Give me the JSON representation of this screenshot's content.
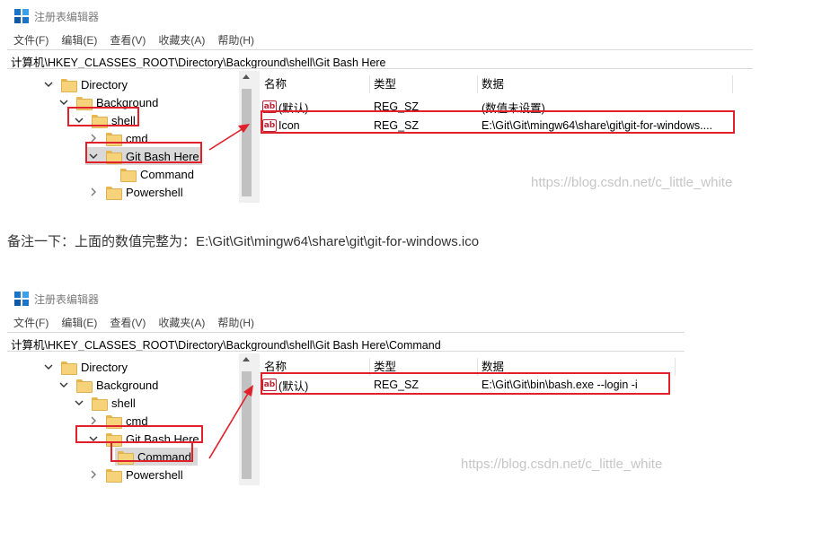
{
  "screenshot1": {
    "title": "注册表编辑器",
    "menu": [
      "文件(F)",
      "编辑(E)",
      "查看(V)",
      "收藏夹(A)",
      "帮助(H)"
    ],
    "address": "计算机\\HKEY_CLASSES_ROOT\\Directory\\Background\\shell\\Git Bash Here",
    "tree": [
      "Directory",
      "Background",
      "shell",
      "cmd",
      "Git Bash Here",
      "Command",
      "Powershell"
    ],
    "columns": [
      "名称",
      "类型",
      "数据"
    ],
    "rows": [
      {
        "name": "(默认)",
        "type": "REG_SZ",
        "data": "(数值未设置)"
      },
      {
        "name": "Icon",
        "type": "REG_SZ",
        "data": "E:\\Git\\Git\\mingw64\\share\\git\\git-for-windows...."
      }
    ],
    "watermark": "https://blog.csdn.net/c_little_white"
  },
  "note": "备注一下：上面的数值完整为：E:\\Git\\Git\\mingw64\\share\\git\\git-for-windows.ico",
  "screenshot2": {
    "title": "注册表编辑器",
    "menu": [
      "文件(F)",
      "编辑(E)",
      "查看(V)",
      "收藏夹(A)",
      "帮助(H)"
    ],
    "address": "计算机\\HKEY_CLASSES_ROOT\\Directory\\Background\\shell\\Git Bash Here\\Command",
    "tree": [
      "Directory",
      "Background",
      "shell",
      "cmd",
      "Git Bash Here",
      "Command",
      "Powershell"
    ],
    "columns": [
      "名称",
      "类型",
      "数据"
    ],
    "rows": [
      {
        "name": "(默认)",
        "type": "REG_SZ",
        "data": "E:\\Git\\Git\\bin\\bash.exe --login -i"
      }
    ],
    "watermark": "https://blog.csdn.net/c_little_white"
  },
  "colors": {
    "highlight_border": "#e0202a",
    "selected_row": "#d9d9d9",
    "folder": "#f6d27a"
  },
  "icons": {
    "app": "registry-editor-icon",
    "folder": "folder-icon",
    "string_value": "ab-string-icon",
    "expand": "chevron-icon"
  }
}
